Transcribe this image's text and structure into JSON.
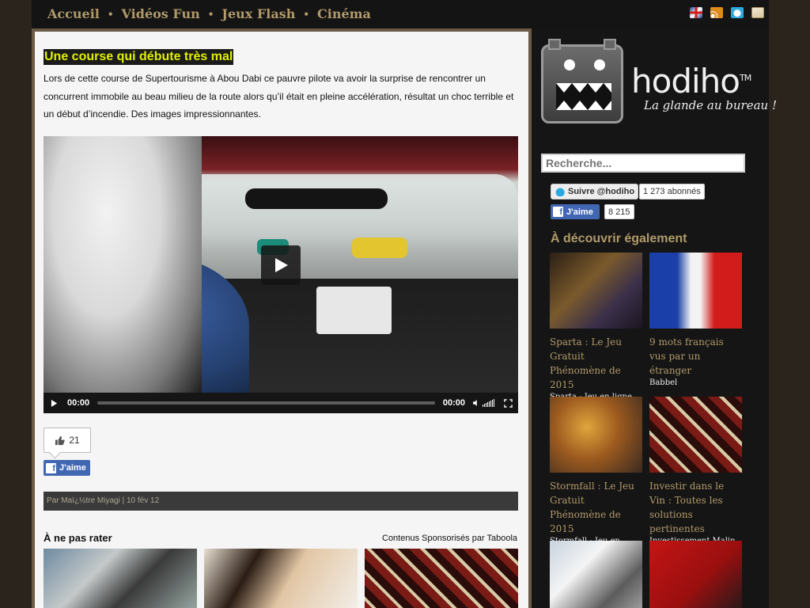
{
  "nav": {
    "items": [
      "Accueil",
      "Vidéos Fun",
      "Jeux Flash",
      "Cinéma"
    ],
    "separator": "•"
  },
  "top_icons": [
    "uk-flag-icon",
    "rss-icon",
    "twitter-icon",
    "mail-icon"
  ],
  "article": {
    "title": "Une course qui débute très mal",
    "body": "Lors de cette course de Supertourisme à Abou Dabi ce pauvre pilote va avoir la surprise de rencontrer un concurrent immobile au beau milieu de la route alors qu’il était en pleine accélération, résultat un choc terrible et un début d’incendie. Des images impressionnantes."
  },
  "video": {
    "current_time": "00:00",
    "duration": "00:00",
    "progress": 0
  },
  "likes": {
    "count": "21",
    "fb_label": "J'aime"
  },
  "meta": {
    "by": "Par",
    "author": "Maï¿½tre Miyagi",
    "separator": "|",
    "date": "10 fév 12"
  },
  "sponsored": {
    "heading": "À ne pas rater",
    "by": "Contenus Sponsorisés par Taboola"
  },
  "sidebar": {
    "logo_text": "hodiho",
    "logo_tm": "TM",
    "logo_tagline": "La glande au bureau !",
    "search_placeholder": "Recherche...",
    "twitter_follow": "Suivre @hodiho",
    "twitter_count": "1 273 abonnés",
    "fb_like": "J'aime",
    "fb_count": "8 215",
    "discover_heading": "À découvrir également",
    "discover_items": [
      {
        "title": "Sparta : Le Jeu Gratuit Phénomène de 2015",
        "source": "Sparta - Jeu en ligne"
      },
      {
        "title": "9 mots français vus par un étranger",
        "source": "Babbel"
      },
      {
        "title": "Stormfall : Le Jeu Gratuit Phénomène de 2015",
        "source": "Stormfall - Jeu en Ligne"
      },
      {
        "title": "Investir dans le Vin : Toutes les solutions pertinentes",
        "source": "Investissement Malin"
      },
      {
        "title": "",
        "source": ""
      },
      {
        "title": "",
        "source": ""
      }
    ]
  },
  "colors": {
    "accent": "#b09a6a",
    "title_highlight": "#e1f000",
    "facebook": "#4267b2"
  }
}
